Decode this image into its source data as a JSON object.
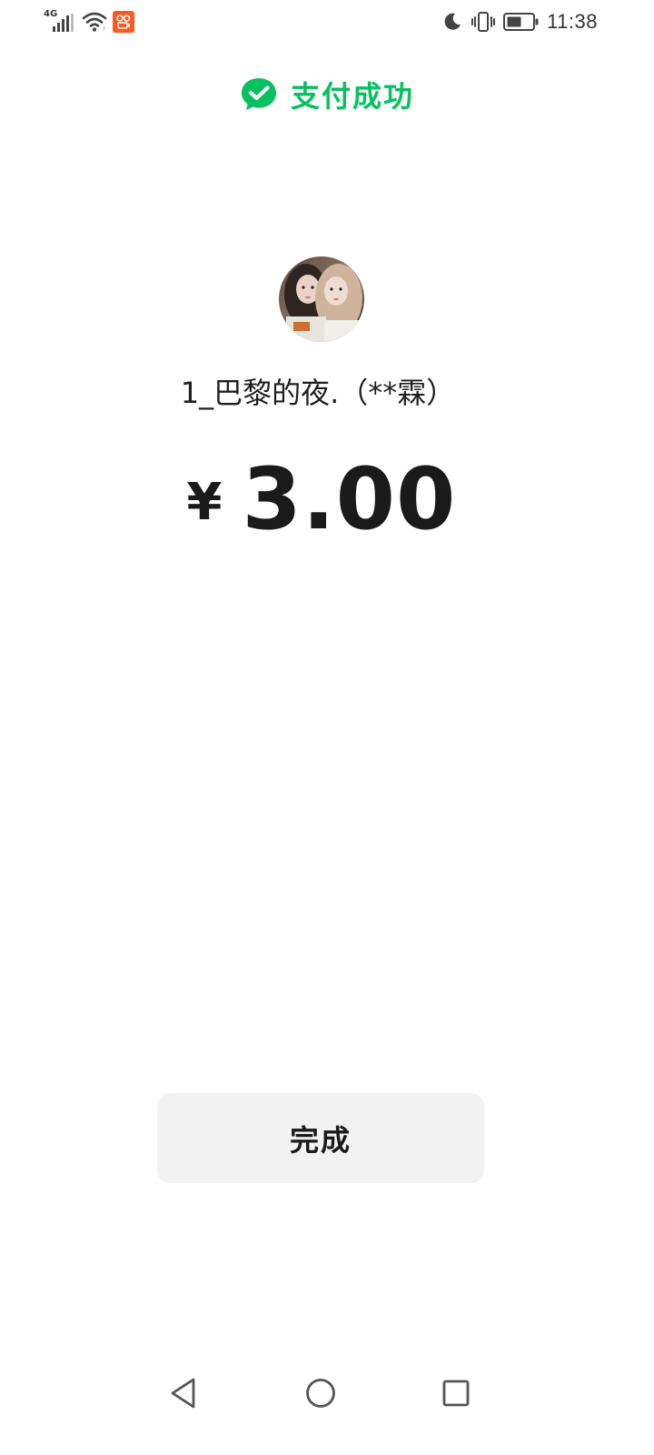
{
  "status_bar": {
    "network_type": "4G",
    "signal_icon": "signal-bars-icon",
    "wifi_icon": "wifi-icon",
    "app_notification_icon": "kuaishou-app-icon",
    "dnd_icon": "moon-icon",
    "vibrate_icon": "vibrate-icon",
    "battery_icon": "battery-icon",
    "time": "11:38"
  },
  "header": {
    "icon": "wechat-pay-icon",
    "title": "支付成功"
  },
  "payee": {
    "avatar": "avatar-photo",
    "name": "1_巴黎的夜.（**霖）"
  },
  "payment": {
    "currency_symbol": "¥",
    "amount": "3.00"
  },
  "actions": {
    "done_label": "完成"
  },
  "nav_bar": {
    "back_icon": "triangle-back-icon",
    "home_icon": "circle-home-icon",
    "recents_icon": "square-recents-icon"
  },
  "colors": {
    "brand_green": "#07c160",
    "text": "#1a1a1a",
    "button_bg": "#f2f2f2"
  }
}
